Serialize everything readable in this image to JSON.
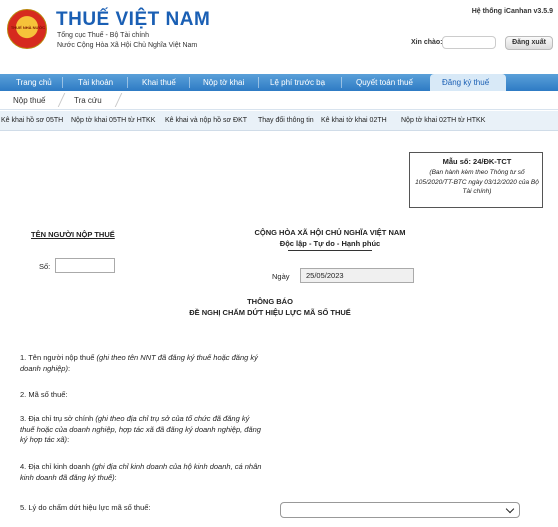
{
  "header": {
    "logo_text": "THUẾ NHÀ NƯỚC",
    "title": "THUẾ VIỆT NAM",
    "subtitle1": "Tổng cục Thuế - Bộ Tài chính",
    "subtitle2": "Nước Cộng Hòa Xã Hội Chủ Nghĩa Việt Nam",
    "system_name": "Hệ thống iCanhan v3.5.9",
    "greeting_label": "Xin chào:",
    "greeting_value": "",
    "logout_label": "Đăng xuất"
  },
  "nav": {
    "items": [
      "Trang chủ",
      "Tài khoản",
      "Khai thuế",
      "Nộp tờ khai",
      "Lệ phí trước bạ",
      "Quyết toán thuế",
      "Đăng ký thuế"
    ],
    "active": "Đăng ký thuế",
    "sub_items": [
      "Nộp thuế",
      "Tra cứu"
    ]
  },
  "function_bar": [
    "Kê khai hồ sơ 05TH",
    "Nộp tờ khai 05TH từ HTKK",
    "Kê khai và nộp hồ sơ ĐKT",
    "Thay đổi thông tin",
    "Kê khai tờ khai 02TH",
    "Nộp tờ khai 02TH từ HTKK"
  ],
  "form": {
    "form_no": "Mẫu số: 24/ĐK-TCT",
    "form_ref": "(Ban hành kèm theo Thông tư số 105/2020/TT-BTC ngày 03/12/2020 của Bộ Tài chính)",
    "taxpayer_title": "TÊN NGƯỜI NỘP THUẾ",
    "gov_title": "CỘNG HÒA XÃ HỘI CHỦ NGHĨA VIỆT NAM",
    "gov_motto": "Độc lập - Tự do - Hạnh phúc",
    "so_label": "Số:",
    "so_value": "",
    "date_label": "Ngày",
    "date_value": "25/05/2023",
    "notice_title1": "THÔNG BÁO",
    "notice_title2": "ĐỀ NGHỊ CHẤM DỨT HIỆU LỰC MÃ SỐ THUẾ",
    "q1_main": "1. Tên người nộp thuế ",
    "q1_note": "(ghi theo tên NNT đã đăng ký thuế hoặc đăng ký doanh nghiệp)",
    "q1_end": ":",
    "q2": "2. Mã số thuế:",
    "q3_main": "3. Địa chỉ trụ sở chính ",
    "q3_note": "(ghi theo địa chỉ trụ sở của tổ chức đã đăng ký thuế hoặc của doanh nghiệp, hợp tác xã đã đăng ký doanh nghiệp, đăng ký hợp tác xã)",
    "q3_end": ":",
    "q4_main": "4. Địa chỉ kinh doanh ",
    "q4_note": "(ghi địa chỉ kinh doanh của hộ kinh doanh, cá nhân kinh doanh đã đăng ký thuế)",
    "q4_end": ":",
    "q5": "5. Lý do chấm dứt hiệu lực mã số thuế:",
    "q5_value": ""
  }
}
